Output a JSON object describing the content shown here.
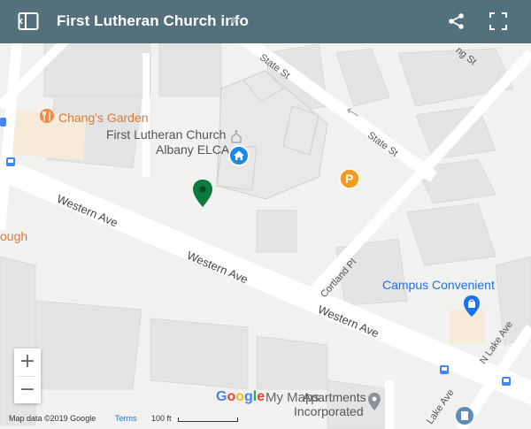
{
  "header": {
    "title": "First Lutheran Church info",
    "star_icon": "star-icon",
    "sidebar_icon": "sidebar-toggle-icon",
    "share_icon": "share-icon",
    "fullscreen_icon": "fullscreen-icon"
  },
  "places": {
    "chang": "Chang's Garden",
    "church_line1": "First Lutheran Church",
    "church_line2": "Albany ELCA",
    "campus": "Campus Convenient",
    "apartments_line1": "Apartments",
    "apartments_line2": "Incorporated",
    "partial_left": "ough"
  },
  "streets": {
    "state_st_1": "State St",
    "state_st_2": "State St",
    "partial_top_right": "ng St",
    "western_1": "Western Ave",
    "western_2": "Western Ave",
    "western_3": "Western Ave",
    "cortland": "Cortland Pl",
    "n_lake": "N Lake Ave",
    "lake_ave": "Lake Ave"
  },
  "controls": {
    "zoom_in": "+",
    "zoom_out": "−"
  },
  "footer": {
    "attribution": "Map data ©2019 Google",
    "terms": "Terms",
    "scale": "100 ft"
  },
  "branding": {
    "google": [
      "G",
      "o",
      "o",
      "g",
      "l",
      "e"
    ],
    "google_colors": [
      "#4285f4",
      "#ea4335",
      "#fbbc05",
      "#4285f4",
      "#34a853",
      "#ea4335"
    ],
    "my_maps": "My Maps"
  },
  "colors": {
    "header_bg": "#54707d",
    "pin_green": "#0b7a3e",
    "church_marker": "#1e88e5",
    "parking": "#f29b1d",
    "restaurant": "#ee8a47"
  }
}
